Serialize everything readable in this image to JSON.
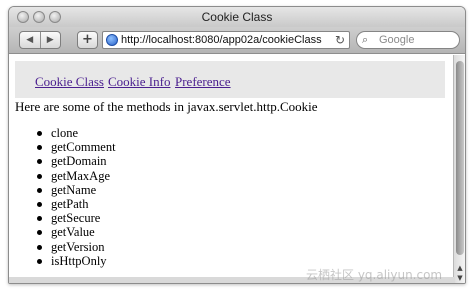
{
  "window": {
    "title": "Cookie Class"
  },
  "toolbar": {
    "back_icon": "back-arrow",
    "forward_icon": "forward-arrow",
    "add_label": "+",
    "url": "http://localhost:8080/app02a/cookieClass",
    "reload_icon": "reload",
    "search_placeholder": "Google"
  },
  "nav": {
    "links": [
      "Cookie Class",
      "Cookie Info",
      "Preference"
    ]
  },
  "main": {
    "intro": "Here are some of the methods in javax.servlet.http.Cookie",
    "methods": [
      "clone",
      "getComment",
      "getDomain",
      "getMaxAge",
      "getName",
      "getPath",
      "getSecure",
      "getValue",
      "getVersion",
      "isHttpOnly"
    ]
  },
  "watermark": "云栖社区 yq.aliyun.com"
}
